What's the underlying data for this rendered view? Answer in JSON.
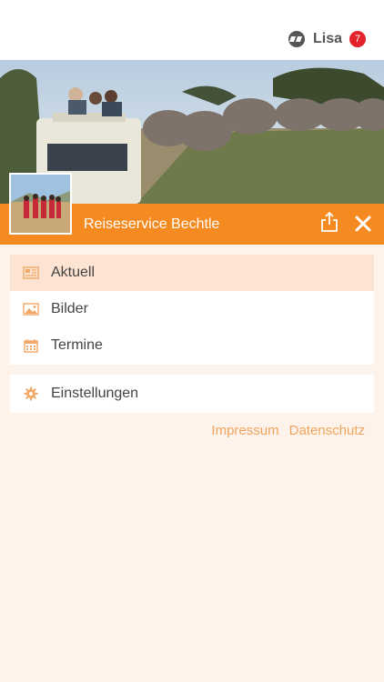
{
  "user": {
    "name": "Lisa",
    "badge": "7"
  },
  "business": {
    "name": "Reiseservice Bechtle"
  },
  "menu": {
    "items": [
      {
        "label": "Aktuell",
        "icon": "newspaper-icon",
        "active": true
      },
      {
        "label": "Bilder",
        "icon": "image-icon",
        "active": false
      },
      {
        "label": "Termine",
        "icon": "calendar-icon",
        "active": false
      }
    ],
    "settings": {
      "label": "Einstellungen",
      "icon": "gear-icon"
    }
  },
  "footer": {
    "impressum": "Impressum",
    "datenschutz": "Datenschutz"
  },
  "colors": {
    "accent": "#f48a20",
    "badge": "#e2232b",
    "background": "#fdf3ea",
    "active_item": "#fde3d1",
    "link": "#f0a45f"
  }
}
